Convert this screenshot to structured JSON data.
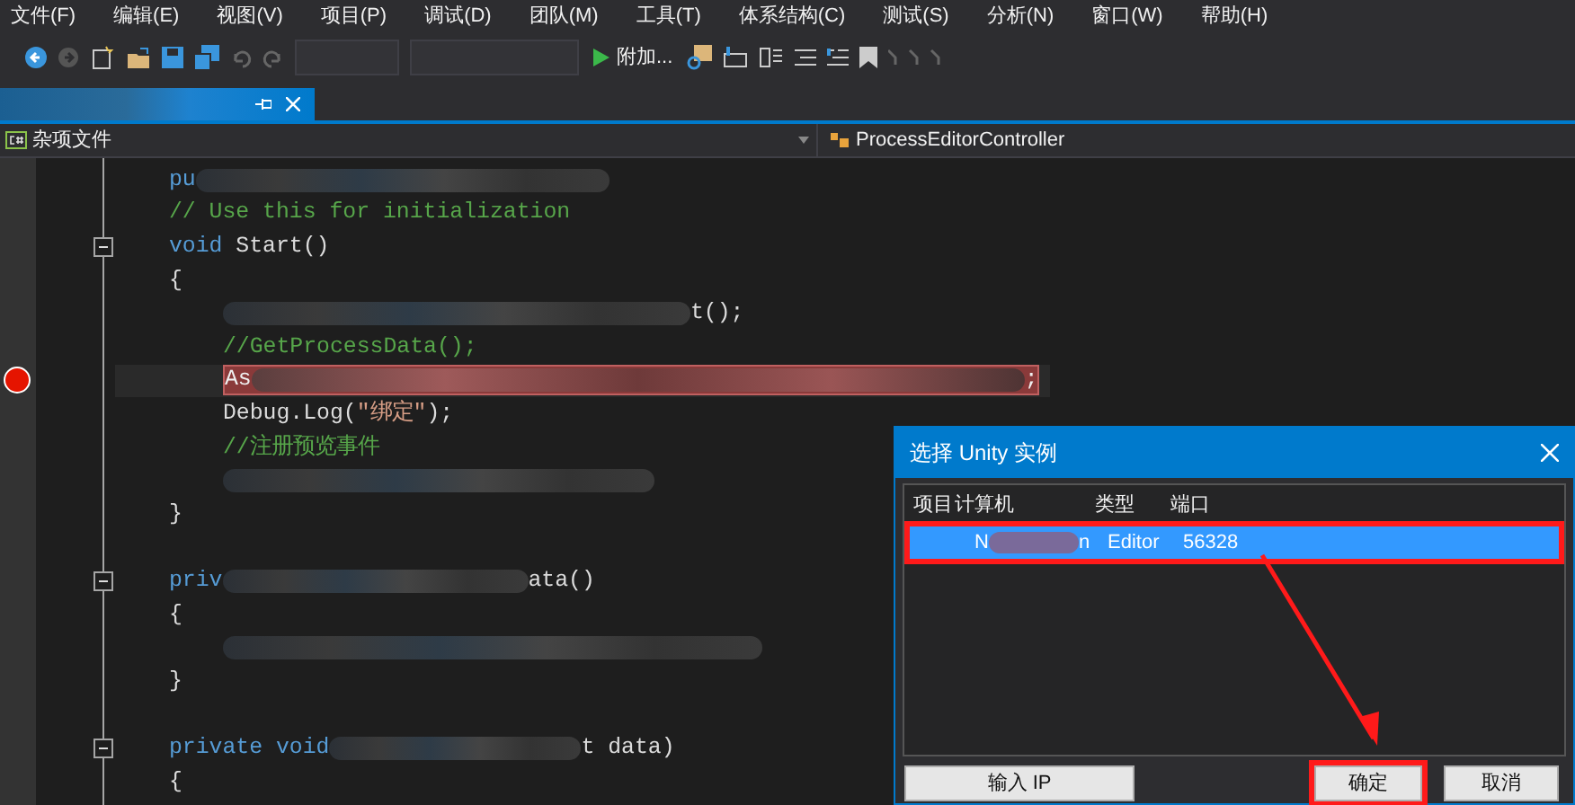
{
  "menu_bar": [
    "文件(F)",
    "编辑(E)",
    "视图(V)",
    "项目(P)",
    "调试(D)",
    "团队(M)",
    "工具(T)",
    "体系结构(C)",
    "测试(S)",
    "分析(N)",
    "窗口(W)",
    "帮助(H)"
  ],
  "toolbar": {
    "attach_button": "附加..."
  },
  "document_tab": {
    "selected": true
  },
  "navigation_bar": {
    "project": "杂项文件",
    "class": "ProcessEditorController"
  },
  "code": {
    "lines": [
      {
        "kind": "code",
        "breakpoint": false,
        "segments": [
          {
            "kind": "keyword",
            "text": "pu"
          },
          {
            "kind": "blur"
          }
        ]
      },
      {
        "kind": "code",
        "breakpoint": false,
        "segments": [
          {
            "kind": "comment",
            "text": "// Use this for initialization"
          }
        ]
      },
      {
        "kind": "declaration",
        "breakpoint": false,
        "segments": [
          {
            "kind": "keyword",
            "text": "void"
          },
          {
            "kind": "plain",
            "text": " Start()"
          }
        ]
      },
      {
        "kind": "code",
        "breakpoint": false,
        "segments": [
          {
            "kind": "plain",
            "text": "{"
          }
        ],
        "children": [
          {
            "kind": "code",
            "breakpoint": false,
            "segments": [
              {
                "kind": "blur"
              },
              {
                "kind": "plain",
                "text": "t();"
              }
            ]
          },
          {
            "kind": "code",
            "breakpoint": false,
            "segments": [
              {
                "kind": "comment",
                "text": "//GetProcessData();"
              }
            ]
          },
          {
            "kind": "code",
            "breakpoint": true,
            "segments": [
              {
                "kind": "plain",
                "text": "As"
              },
              {
                "kind": "blur"
              },
              {
                "kind": "plain",
                "text": ";"
              }
            ]
          },
          {
            "kind": "code",
            "breakpoint": false,
            "segments": [
              {
                "kind": "plain",
                "text": "Debug.Log("
              },
              {
                "kind": "string",
                "text": "\"绑定\""
              },
              {
                "kind": "plain",
                "text": ");"
              }
            ]
          },
          {
            "kind": "code",
            "breakpoint": false,
            "segments": [
              {
                "kind": "comment",
                "text": "//注册预览事件"
              }
            ]
          },
          {
            "kind": "code",
            "breakpoint": false,
            "segments": [
              {
                "kind": "blur"
              }
            ]
          }
        ]
      },
      {
        "kind": "code",
        "breakpoint": false,
        "segments": [
          {
            "kind": "plain",
            "text": "}"
          }
        ]
      },
      {
        "kind": "blank"
      },
      {
        "kind": "declaration",
        "breakpoint": false,
        "segments": [
          {
            "kind": "keyword",
            "text": "priv"
          },
          {
            "kind": "blur"
          },
          {
            "kind": "plain",
            "text": "ata()"
          }
        ]
      },
      {
        "kind": "code",
        "breakpoint": false,
        "segments": [
          {
            "kind": "plain",
            "text": "{"
          }
        ],
        "children": [
          {
            "kind": "code",
            "breakpoint": false,
            "segments": [
              {
                "kind": "blur"
              }
            ]
          }
        ]
      },
      {
        "kind": "code",
        "breakpoint": false,
        "segments": [
          {
            "kind": "plain",
            "text": "}"
          }
        ]
      },
      {
        "kind": "blank"
      },
      {
        "kind": "declaration",
        "breakpoint": false,
        "segments": [
          {
            "kind": "keyword",
            "text": "private void"
          },
          {
            "kind": "blur"
          },
          {
            "kind": "plain",
            "text": "t data)"
          }
        ]
      },
      {
        "kind": "code",
        "breakpoint": false,
        "segments": [
          {
            "kind": "plain",
            "text": "{"
          }
        ]
      }
    ]
  },
  "dialog": {
    "title": "选择 Unity 实例",
    "columns": [
      "项目",
      "计算机",
      "类型",
      "端口"
    ],
    "rows": [
      {
        "selected": true,
        "machine_start": "N",
        "machine_end": "n",
        "type": "Editor",
        "port": "56328"
      }
    ],
    "buttons": [
      "输入 IP",
      "确定",
      "取消"
    ]
  }
}
